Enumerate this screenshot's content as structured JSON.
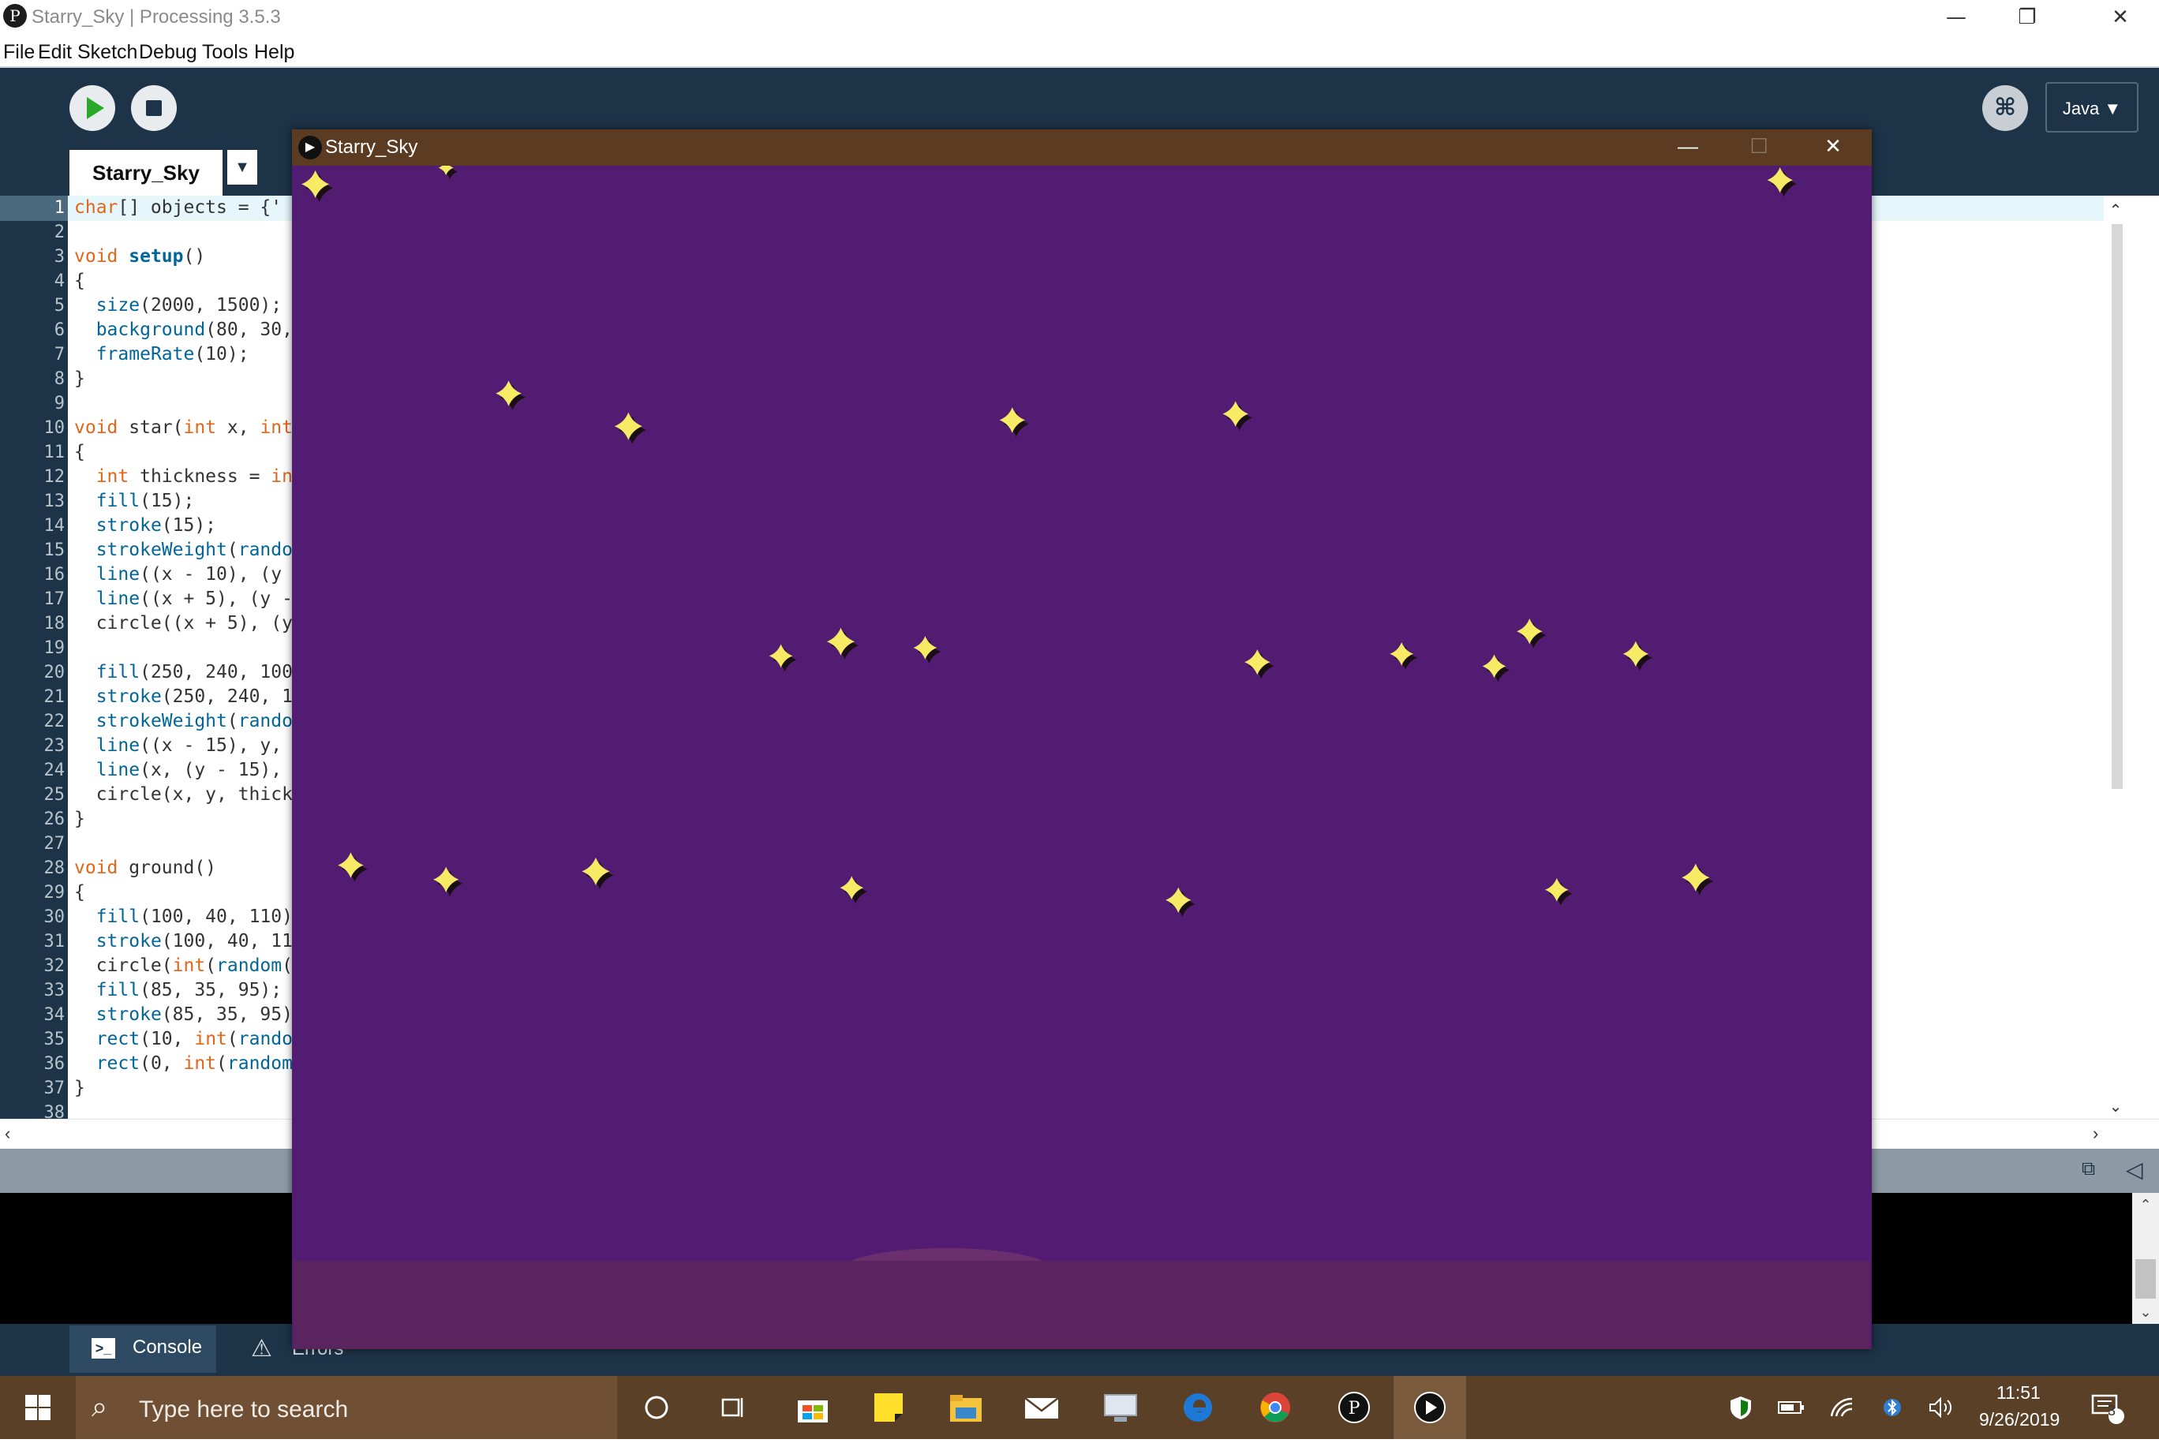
{
  "app": {
    "title": "Starry_Sky | Processing 3.5.3",
    "logo_glyph": "P",
    "window_controls": {
      "minimize": "—",
      "restore": "❐",
      "close": "✕"
    }
  },
  "menu": {
    "items": [
      "File",
      "Edit",
      "Sketch",
      "Debug",
      "Tools",
      "Help"
    ]
  },
  "toolbar": {
    "run_icon": "play-icon",
    "stop_icon": "stop-icon",
    "debug_glyph": "⌘",
    "mode": "Java ▼"
  },
  "tabs": {
    "active": "Starry_Sky",
    "menu_glyph": "▼"
  },
  "editor": {
    "lines": [
      {
        "n": "1",
        "tokens": [
          {
            "t": "char",
            "c": "type"
          },
          {
            "t": "[] objects = {'",
            "c": "plain"
          }
        ]
      },
      {
        "n": "2",
        "tokens": []
      },
      {
        "n": "3",
        "tokens": [
          {
            "t": "void ",
            "c": "type"
          },
          {
            "t": "setup",
            "c": "bold"
          },
          {
            "t": "()",
            "c": "plain"
          }
        ]
      },
      {
        "n": "4",
        "tokens": [
          {
            "t": "{",
            "c": "plain"
          }
        ]
      },
      {
        "n": "5",
        "tokens": [
          {
            "t": "  ",
            "c": "plain"
          },
          {
            "t": "size",
            "c": "fn"
          },
          {
            "t": "(2000, 1500);",
            "c": "plain"
          }
        ]
      },
      {
        "n": "6",
        "tokens": [
          {
            "t": "  ",
            "c": "plain"
          },
          {
            "t": "background",
            "c": "fn"
          },
          {
            "t": "(80, 30,",
            "c": "plain"
          }
        ]
      },
      {
        "n": "7",
        "tokens": [
          {
            "t": "  ",
            "c": "plain"
          },
          {
            "t": "frameRate",
            "c": "fn"
          },
          {
            "t": "(10);",
            "c": "plain"
          }
        ]
      },
      {
        "n": "8",
        "tokens": [
          {
            "t": "}",
            "c": "plain"
          }
        ]
      },
      {
        "n": "9",
        "tokens": []
      },
      {
        "n": "10",
        "tokens": [
          {
            "t": "void ",
            "c": "type"
          },
          {
            "t": "star(",
            "c": "plain"
          },
          {
            "t": "int",
            "c": "type"
          },
          {
            "t": " x, ",
            "c": "plain"
          },
          {
            "t": "int",
            "c": "type"
          }
        ]
      },
      {
        "n": "11",
        "tokens": [
          {
            "t": "{",
            "c": "plain"
          }
        ]
      },
      {
        "n": "12",
        "tokens": [
          {
            "t": "  ",
            "c": "plain"
          },
          {
            "t": "int",
            "c": "type"
          },
          {
            "t": " thickness = ",
            "c": "plain"
          },
          {
            "t": "in",
            "c": "type"
          }
        ]
      },
      {
        "n": "13",
        "tokens": [
          {
            "t": "  ",
            "c": "plain"
          },
          {
            "t": "fill",
            "c": "fn"
          },
          {
            "t": "(15);",
            "c": "plain"
          }
        ]
      },
      {
        "n": "14",
        "tokens": [
          {
            "t": "  ",
            "c": "plain"
          },
          {
            "t": "stroke",
            "c": "fn"
          },
          {
            "t": "(15);",
            "c": "plain"
          }
        ]
      },
      {
        "n": "15",
        "tokens": [
          {
            "t": "  ",
            "c": "plain"
          },
          {
            "t": "strokeWeight",
            "c": "fn"
          },
          {
            "t": "(",
            "c": "plain"
          },
          {
            "t": "rando",
            "c": "fn"
          }
        ]
      },
      {
        "n": "16",
        "tokens": [
          {
            "t": "  ",
            "c": "plain"
          },
          {
            "t": "line",
            "c": "fn"
          },
          {
            "t": "((x - 10), (y",
            "c": "plain"
          }
        ]
      },
      {
        "n": "17",
        "tokens": [
          {
            "t": "  ",
            "c": "plain"
          },
          {
            "t": "line",
            "c": "fn"
          },
          {
            "t": "((x + 5), (y -",
            "c": "plain"
          }
        ]
      },
      {
        "n": "18",
        "tokens": [
          {
            "t": "  circle((x + 5), (y",
            "c": "plain"
          }
        ]
      },
      {
        "n": "19",
        "tokens": []
      },
      {
        "n": "20",
        "tokens": [
          {
            "t": "  ",
            "c": "plain"
          },
          {
            "t": "fill",
            "c": "fn"
          },
          {
            "t": "(250, 240, 100",
            "c": "plain"
          }
        ]
      },
      {
        "n": "21",
        "tokens": [
          {
            "t": "  ",
            "c": "plain"
          },
          {
            "t": "stroke",
            "c": "fn"
          },
          {
            "t": "(250, 240, 1",
            "c": "plain"
          }
        ]
      },
      {
        "n": "22",
        "tokens": [
          {
            "t": "  ",
            "c": "plain"
          },
          {
            "t": "strokeWeight",
            "c": "fn"
          },
          {
            "t": "(",
            "c": "plain"
          },
          {
            "t": "rando",
            "c": "fn"
          }
        ]
      },
      {
        "n": "23",
        "tokens": [
          {
            "t": "  ",
            "c": "plain"
          },
          {
            "t": "line",
            "c": "fn"
          },
          {
            "t": "((x - 15), y,",
            "c": "plain"
          }
        ]
      },
      {
        "n": "24",
        "tokens": [
          {
            "t": "  ",
            "c": "plain"
          },
          {
            "t": "line",
            "c": "fn"
          },
          {
            "t": "(x, (y - 15),",
            "c": "plain"
          }
        ]
      },
      {
        "n": "25",
        "tokens": [
          {
            "t": "  circle(x, y, thick",
            "c": "plain"
          }
        ]
      },
      {
        "n": "26",
        "tokens": [
          {
            "t": "}",
            "c": "plain"
          }
        ]
      },
      {
        "n": "27",
        "tokens": []
      },
      {
        "n": "28",
        "tokens": [
          {
            "t": "void ",
            "c": "type"
          },
          {
            "t": "ground()",
            "c": "plain"
          }
        ]
      },
      {
        "n": "29",
        "tokens": [
          {
            "t": "{",
            "c": "plain"
          }
        ]
      },
      {
        "n": "30",
        "tokens": [
          {
            "t": "  ",
            "c": "plain"
          },
          {
            "t": "fill",
            "c": "fn"
          },
          {
            "t": "(100, 40, 110)",
            "c": "plain"
          }
        ]
      },
      {
        "n": "31",
        "tokens": [
          {
            "t": "  ",
            "c": "plain"
          },
          {
            "t": "stroke",
            "c": "fn"
          },
          {
            "t": "(100, 40, 11",
            "c": "plain"
          }
        ]
      },
      {
        "n": "32",
        "tokens": [
          {
            "t": "  circle(",
            "c": "plain"
          },
          {
            "t": "int",
            "c": "type"
          },
          {
            "t": "(",
            "c": "plain"
          },
          {
            "t": "random",
            "c": "fn"
          },
          {
            "t": "(",
            "c": "plain"
          }
        ]
      },
      {
        "n": "33",
        "tokens": [
          {
            "t": "  ",
            "c": "plain"
          },
          {
            "t": "fill",
            "c": "fn"
          },
          {
            "t": "(85, 35, 95);",
            "c": "plain"
          }
        ]
      },
      {
        "n": "34",
        "tokens": [
          {
            "t": "  ",
            "c": "plain"
          },
          {
            "t": "stroke",
            "c": "fn"
          },
          {
            "t": "(85, 35, 95)",
            "c": "plain"
          }
        ]
      },
      {
        "n": "35",
        "tokens": [
          {
            "t": "  ",
            "c": "plain"
          },
          {
            "t": "rect",
            "c": "fn"
          },
          {
            "t": "(10, ",
            "c": "plain"
          },
          {
            "t": "int",
            "c": "type"
          },
          {
            "t": "(",
            "c": "plain"
          },
          {
            "t": "rando",
            "c": "fn"
          }
        ]
      },
      {
        "n": "36",
        "tokens": [
          {
            "t": "  ",
            "c": "plain"
          },
          {
            "t": "rect",
            "c": "fn"
          },
          {
            "t": "(0, ",
            "c": "plain"
          },
          {
            "t": "int",
            "c": "type"
          },
          {
            "t": "(",
            "c": "plain"
          },
          {
            "t": "random",
            "c": "fn"
          }
        ]
      },
      {
        "n": "37",
        "tokens": [
          {
            "t": "}",
            "c": "plain"
          }
        ]
      },
      {
        "n": "38",
        "tokens": []
      }
    ]
  },
  "status": {
    "copy_icon": "copy-icon",
    "collapse_glyph": "◁"
  },
  "footer": {
    "console_label": "Console",
    "console_glyph": ">_",
    "errors_label": "Errors",
    "errors_glyph": "⚠"
  },
  "sketch": {
    "title": "Starry_Sky",
    "controls": {
      "minimize": "—",
      "maximize": "☐",
      "close": "✕"
    },
    "background": "#531c73",
    "ground_color": "#5a255e",
    "star_color": "#f7ea64"
  },
  "taskbar": {
    "search_placeholder": "Type here to search",
    "apps": [
      "cortana-icon",
      "task-view-icon",
      "store-icon",
      "sticky-notes-icon",
      "file-explorer-icon",
      "mail-icon",
      "remote-desktop-icon",
      "edge-icon",
      "chrome-icon",
      "processing-icon",
      "sketch-running-icon"
    ],
    "time": "11:51",
    "date": "9/26/2019",
    "notification_count": "3"
  }
}
